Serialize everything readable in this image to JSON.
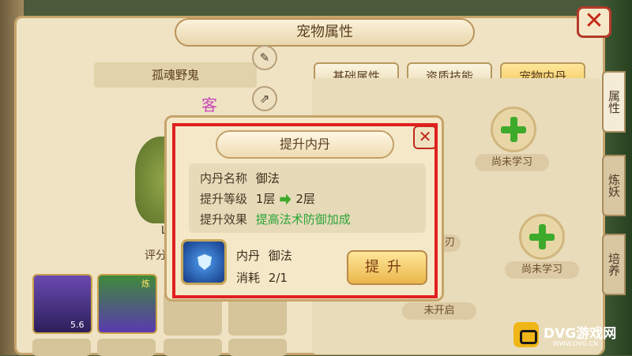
{
  "window": {
    "title": "宠物属性",
    "close_label": "✕"
  },
  "pet": {
    "name": "孤魂野鬼",
    "score_label": "评分",
    "level_partial": "Lv",
    "rank_char": "客"
  },
  "tabs": [
    {
      "label": "基础属性",
      "active": false
    },
    {
      "label": "资质技能",
      "active": false
    },
    {
      "label": "宠物内丹",
      "active": true
    }
  ],
  "side_tabs": [
    {
      "label": "属性",
      "active": true
    },
    {
      "label": "炼妖",
      "active": false
    },
    {
      "label": "培养",
      "active": false
    }
  ],
  "skill_slots": [
    {
      "label": "尚未学习"
    },
    {
      "label": "尚未学习"
    },
    {
      "label": "未开启"
    },
    {
      "label": "护刃"
    }
  ],
  "heroes": [
    {
      "badge": "5.6"
    },
    {
      "badge": "炼"
    }
  ],
  "dialog": {
    "title": "提升内丹",
    "close_label": "✕",
    "rows": {
      "name_label": "内丹名称",
      "name_value": "御法",
      "level_label": "提升等级",
      "level_from": "1层",
      "level_to": "2层",
      "effect_label": "提升效果",
      "effect_value": "提高法术防御加成"
    },
    "item": {
      "kind_label": "内丹",
      "kind_value": "御法",
      "cost_label": "消耗",
      "cost_value": "2/1"
    },
    "upgrade_label": "提升"
  },
  "watermark": {
    "text": "DVG游戏网",
    "sub": "WWW.DVG.CN"
  },
  "colors": {
    "highlight_frame": "#e02020",
    "accent_green": "#2ca43a"
  }
}
